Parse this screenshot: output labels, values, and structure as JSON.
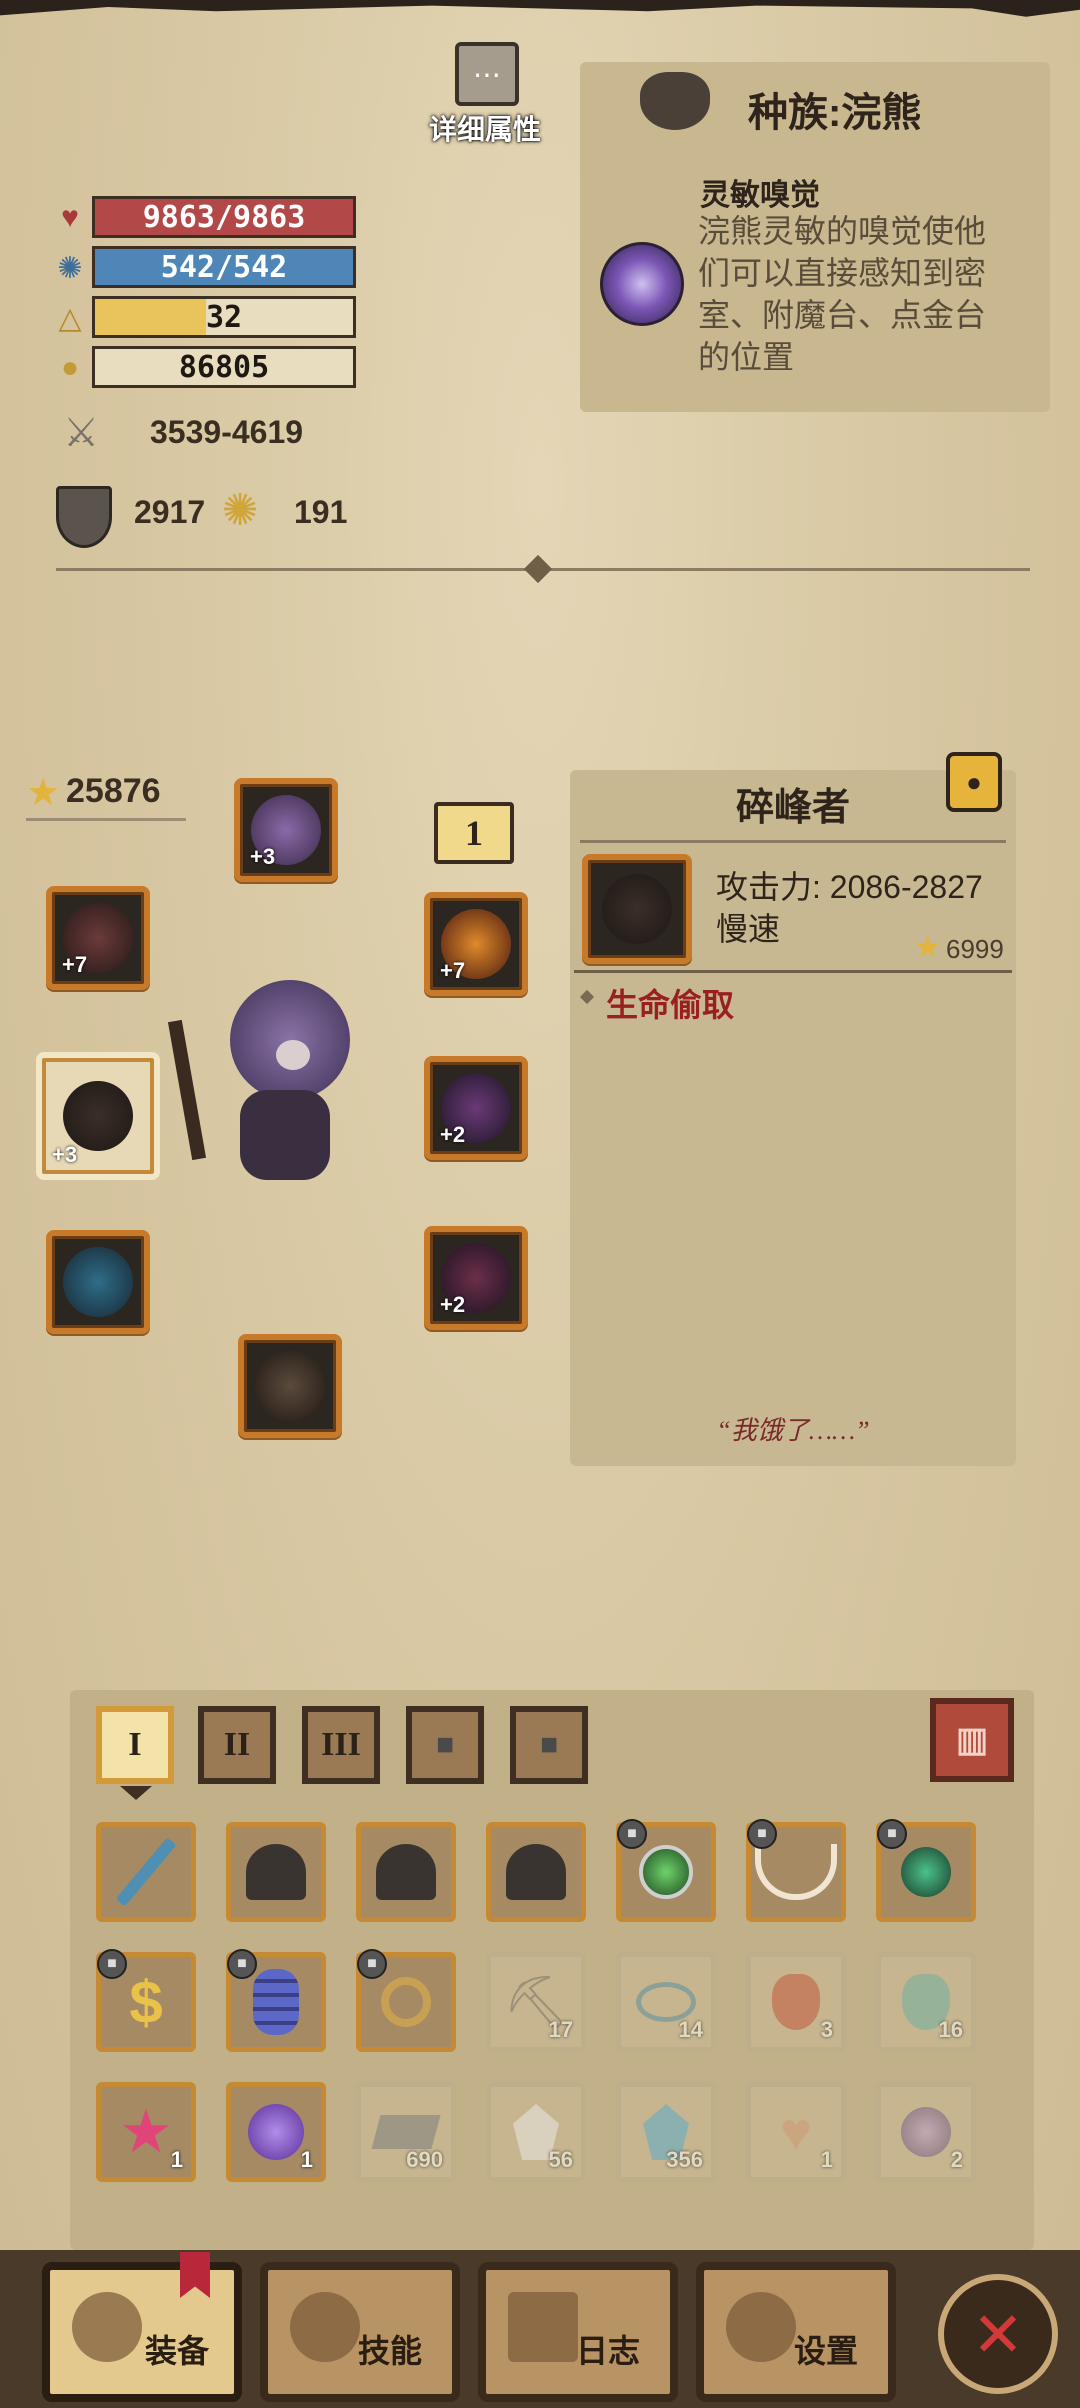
{
  "header": {
    "detail_label": "详细属性",
    "race_title": "种族:浣熊"
  },
  "trait": {
    "name": "灵敏嗅觉",
    "description": "浣熊灵敏的嗅觉使他们可以直接感知到密室、附魔台、点金台的位置"
  },
  "stats": {
    "hp": {
      "text": "9863/9863",
      "fill": 1.0,
      "color": "#b24848"
    },
    "mp": {
      "text": "542/542",
      "fill": 1.0,
      "color": "#4f86b8"
    },
    "level": {
      "text": "32",
      "fill": 0.43,
      "color": "#e8c45a"
    },
    "gold": {
      "text": "86805"
    },
    "attack": "3539-4619",
    "defense": "2917",
    "luck": "191"
  },
  "score": "25876",
  "slot_badge": "1",
  "equipment": {
    "helmet_plus": "+3",
    "left_top_plus": "+7",
    "weapon_plus": "+3",
    "right_top_plus": "+7",
    "right_mid_plus": "+2",
    "right_low_plus": "+2"
  },
  "item_detail": {
    "name": "碎峰者",
    "attack": "攻击力: 2086-2827",
    "speed": "慢速",
    "value": "6999",
    "effect": "生命偷取",
    "quote": "“我饿了……”"
  },
  "inventory": {
    "tabs": [
      "I",
      "II",
      "III"
    ],
    "counts": {
      "r2c5": "17",
      "r2c6": "14",
      "r2c7": "3",
      "r2c8": "16",
      "r3c1": "1",
      "r3c2": "1",
      "r3c3": "690",
      "r3c4": "56",
      "r3c5": "356",
      "r3c6": "1",
      "r3c7": "2"
    }
  },
  "nav": {
    "equipment": "装备",
    "skills": "技能",
    "log": "日志",
    "settings": "设置"
  },
  "icons": {
    "heart": "heart-icon",
    "mana": "mana-icon",
    "level": "level-triangle-icon",
    "gold": "gold-coins-icon",
    "attack": "crossed-swords-icon",
    "defense": "shield-icon",
    "luck": "luck-charm-icon",
    "star": "star-icon",
    "lock": "lock-icon",
    "trash": "trash-icon",
    "close": "close-icon"
  }
}
